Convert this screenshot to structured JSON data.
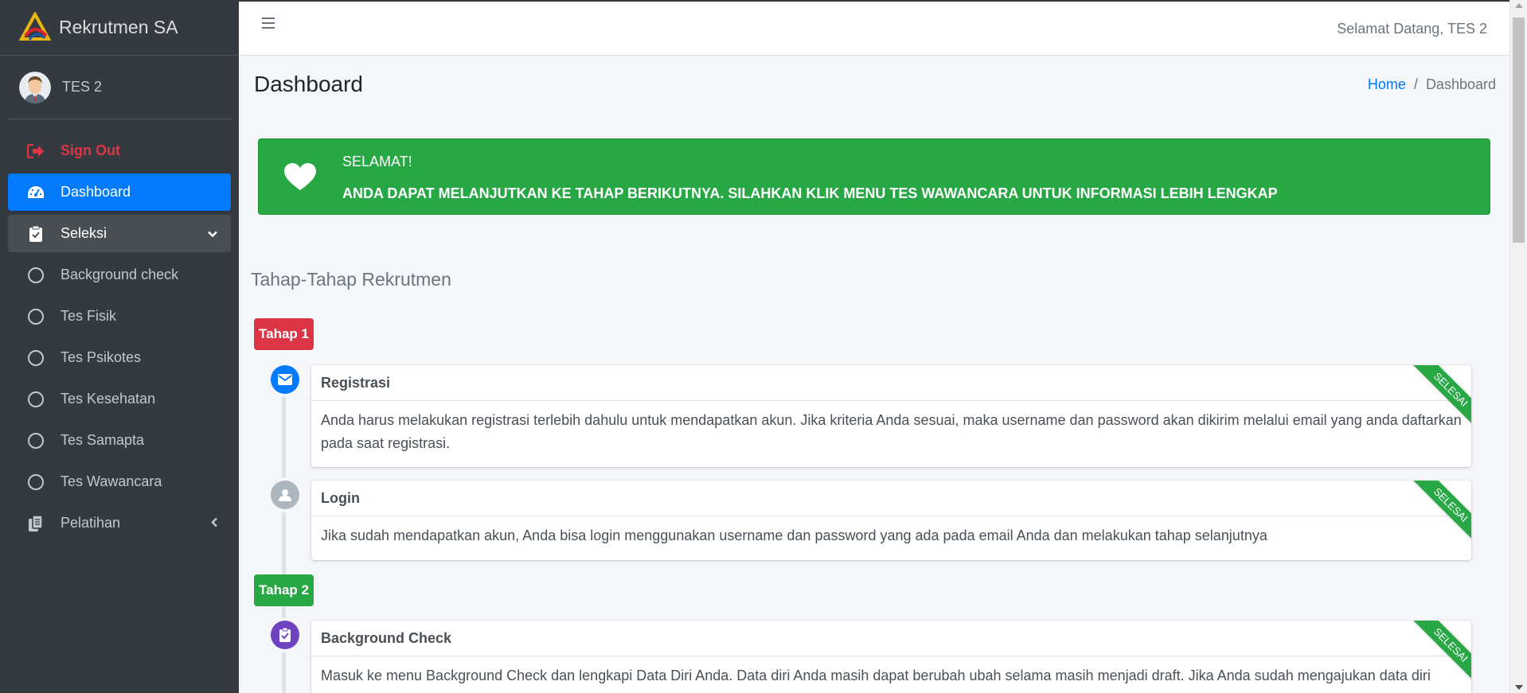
{
  "brand": {
    "name": "Rekrutmen SA"
  },
  "user": {
    "name": "TES 2"
  },
  "sidebar": {
    "items": [
      {
        "label": "Sign Out",
        "icon": "sign-out-icon"
      },
      {
        "label": "Dashboard",
        "icon": "tachometer-icon"
      },
      {
        "label": "Seleksi",
        "icon": "clipboard-check-icon"
      },
      {
        "label": "Background check",
        "icon": "circle-icon"
      },
      {
        "label": "Tes Fisik",
        "icon": "circle-icon"
      },
      {
        "label": "Tes Psikotes",
        "icon": "circle-icon"
      },
      {
        "label": "Tes Kesehatan",
        "icon": "circle-icon"
      },
      {
        "label": "Tes Samapta",
        "icon": "circle-icon"
      },
      {
        "label": "Tes Wawancara",
        "icon": "circle-icon"
      },
      {
        "label": "Pelatihan",
        "icon": "copy-icon"
      }
    ]
  },
  "topbar": {
    "welcome": "Selamat Datang, TES 2"
  },
  "header": {
    "title": "Dashboard"
  },
  "breadcrumb": {
    "home": "Home",
    "separator": "/",
    "current": "Dashboard"
  },
  "alert": {
    "title": "SELAMAT!",
    "text": "ANDA DAPAT MELANJUTKAN KE TAHAP BERIKUTNYA. SILAHKAN KLIK MENU TES WAWANCARA UNTUK INFORMASI LEBIH LENGKAP"
  },
  "timeline": {
    "section_title": "Tahap-Tahap Rekrutmen",
    "labels": [
      "Tahap 1",
      "Tahap 2"
    ],
    "items": [
      {
        "title": "Registrasi",
        "body": "Anda harus melakukan registrasi terlebih dahulu untuk mendapatkan akun. Jika kriteria Anda sesuai, maka username dan password akan dikirim melalui email yang anda daftarkan pada saat registrasi.",
        "status": "SELESAI",
        "icon": "envelope-icon"
      },
      {
        "title": "Login",
        "body": "Jika sudah mendapatkan akun, Anda bisa login menggunakan username dan password yang ada pada email Anda dan melakukan tahap selanjutnya",
        "status": "SELESAI",
        "icon": "user-icon"
      },
      {
        "title": "Background Check",
        "body": "Masuk ke menu Background Check dan lengkapi Data Diri Anda. Data diri Anda masih dapat berubah ubah selama masih menjadi draft. Jika Anda sudah mengajukan data diri",
        "status": "SELESAI",
        "icon": "clipboard-check-icon"
      }
    ]
  },
  "colors": {
    "sidebar_bg": "#343a40",
    "active": "#007bff",
    "success": "#28a745",
    "danger": "#dc3545",
    "purple": "#6f42c1",
    "gray": "#adb5bd"
  }
}
